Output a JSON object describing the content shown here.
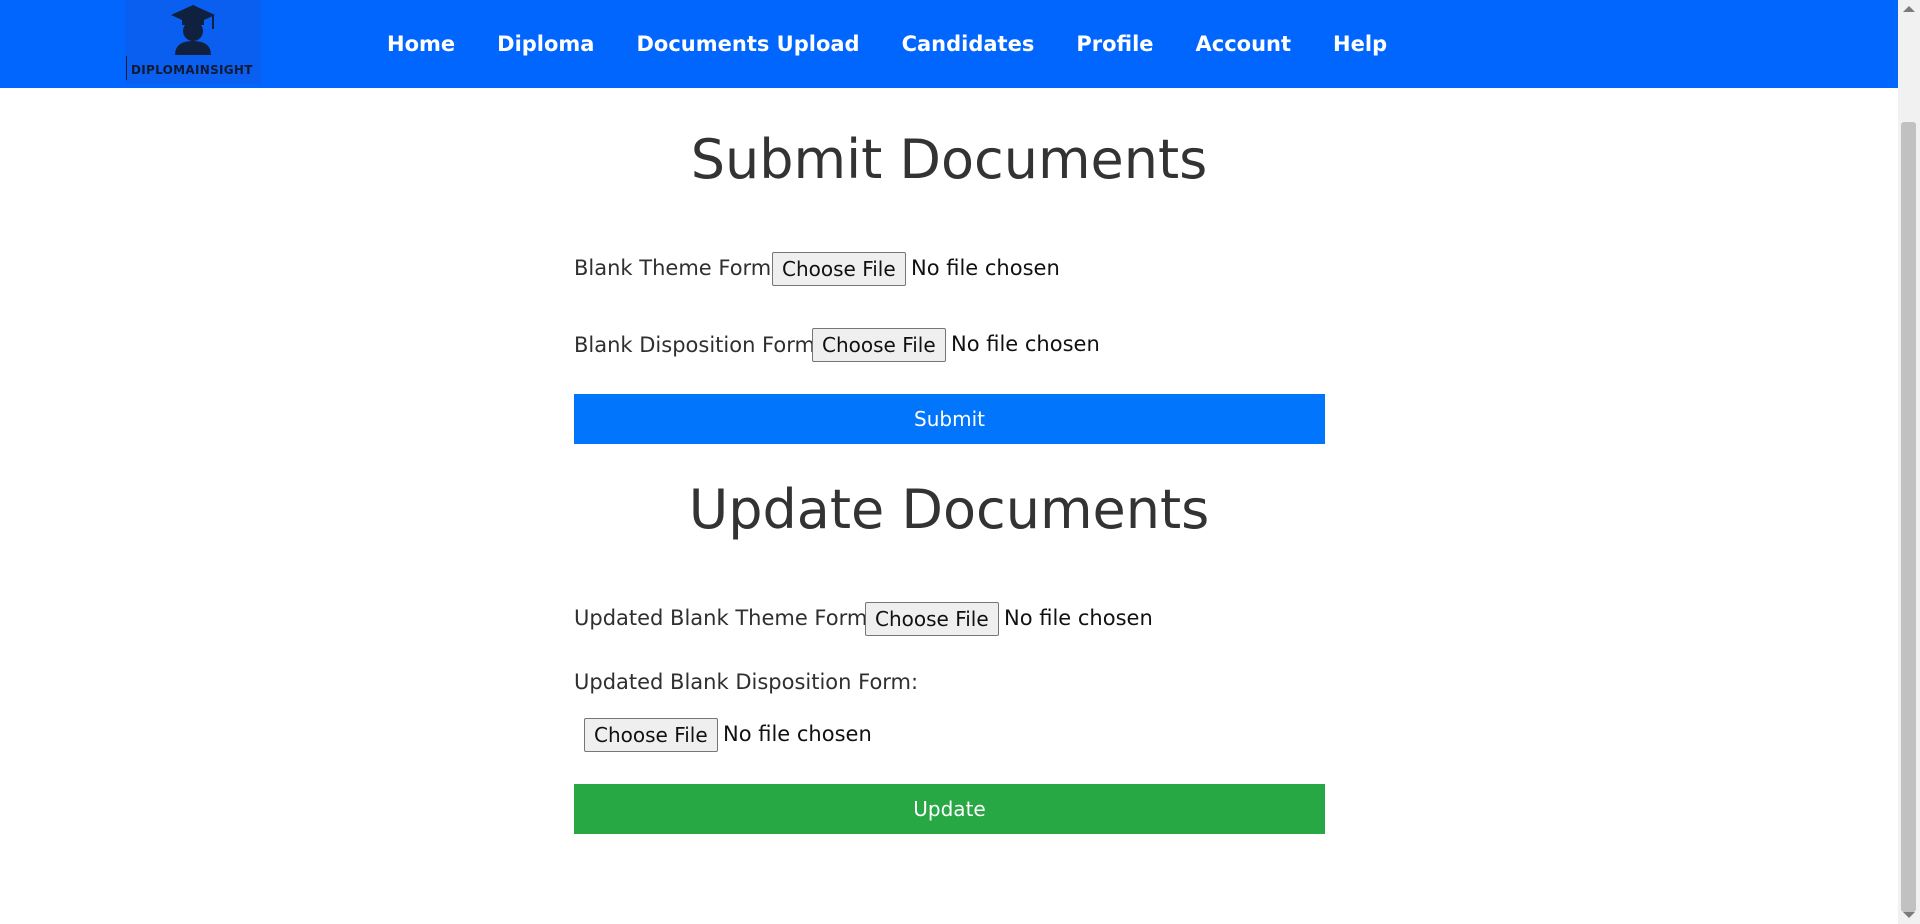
{
  "brand": {
    "name": "DIPLOMAINSIGHT",
    "icon": "graduate-cap-icon"
  },
  "nav": [
    "Home",
    "Diploma",
    "Documents Upload",
    "Candidates",
    "Profile",
    "Account",
    "Help"
  ],
  "submit_section": {
    "title": "Submit Documents",
    "fields": [
      {
        "label": "Blank Theme Form:",
        "button": "Choose File",
        "status": "No file chosen"
      },
      {
        "label": "Blank Disposition Form:",
        "button": "Choose File",
        "status": "No file chosen"
      }
    ],
    "button": "Submit"
  },
  "update_section": {
    "title": "Update Documents",
    "fields": [
      {
        "label": "Updated Blank Theme Form:",
        "button": "Choose File",
        "status": "No file chosen"
      },
      {
        "label": "Updated Blank Disposition Form:",
        "button": "Choose File",
        "status": "No file chosen"
      }
    ],
    "button": "Update"
  },
  "colors": {
    "nav": "#0166fe",
    "submit": "#0176fd",
    "update": "#28a745"
  }
}
